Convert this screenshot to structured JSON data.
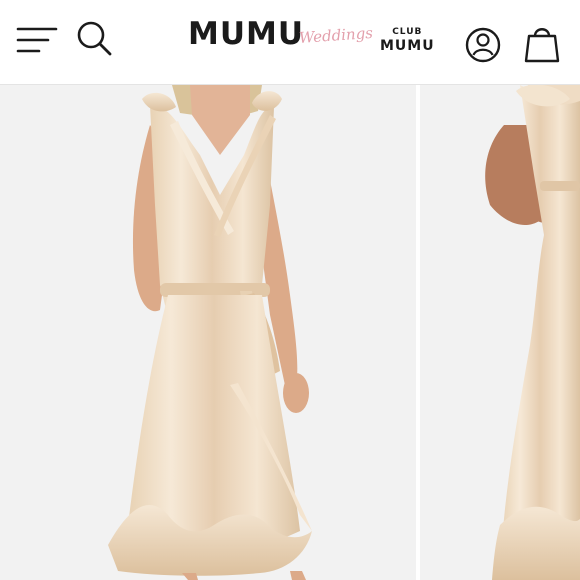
{
  "header": {
    "brand": {
      "main": "MUMU",
      "script": "Weddings"
    },
    "club": {
      "top": "CLUB",
      "bottom": "MUMU"
    },
    "icons": [
      "menu-icon",
      "search-icon",
      "account-icon",
      "bag-icon"
    ]
  },
  "gallery": {
    "images": [
      "dress-front-photo",
      "dress-side-photo"
    ]
  },
  "colors": {
    "brand_text": "#1b1b1b",
    "script_accent": "#e3a0ac",
    "dress": "#efdcc2",
    "background": "#f2f2f2"
  }
}
